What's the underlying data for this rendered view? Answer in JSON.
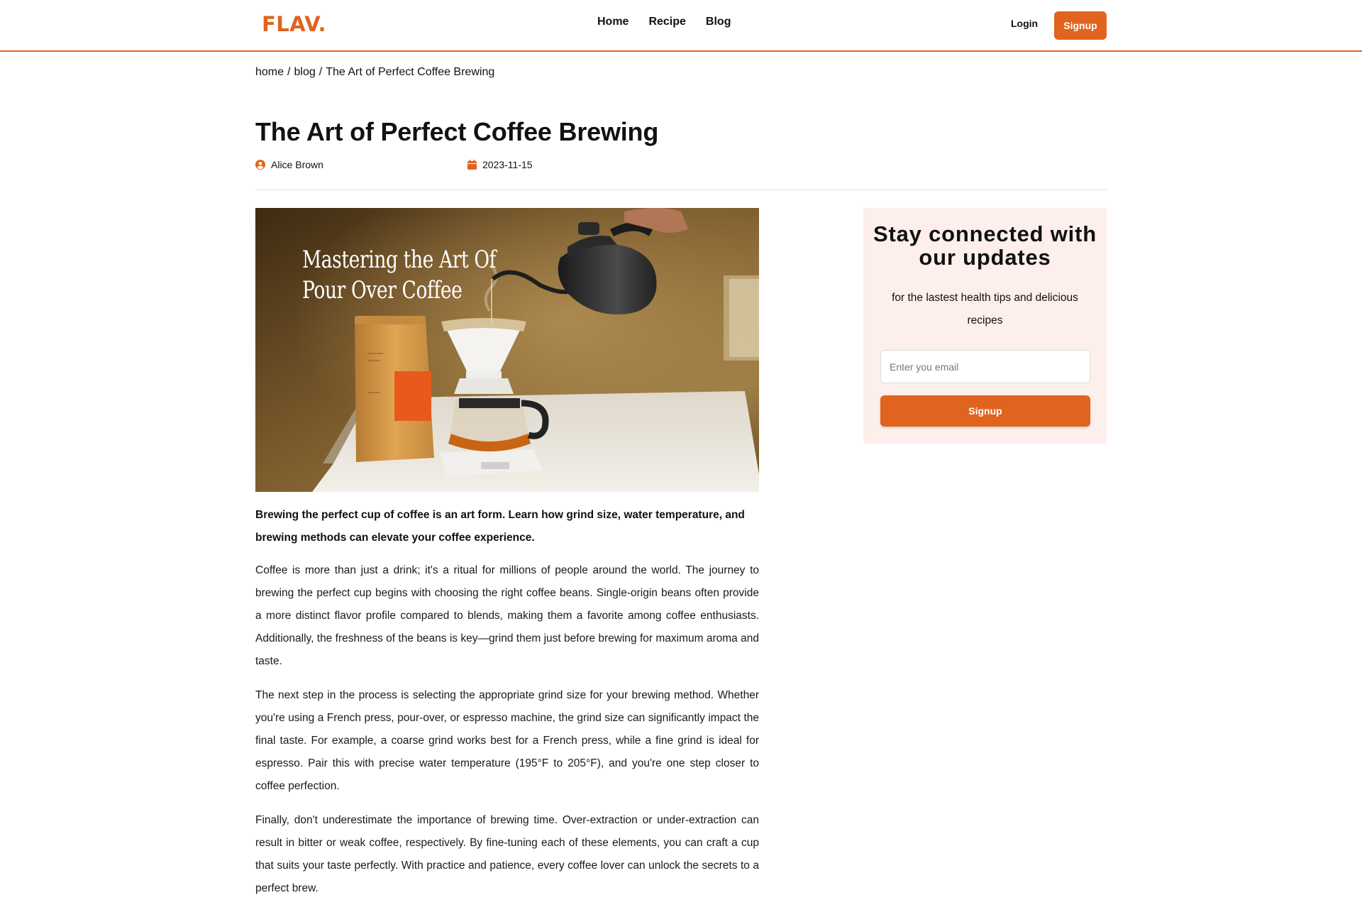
{
  "brand": {
    "logo_text": "FLAV.",
    "accent_color": "#E0641E"
  },
  "nav": {
    "items": [
      {
        "label": "Home"
      },
      {
        "label": "Recipe"
      },
      {
        "label": "Blog"
      }
    ],
    "login_label": "Login",
    "signup_label": "Signup"
  },
  "breadcrumb": {
    "home": "home",
    "blog": "blog",
    "current": "The Art of Perfect Coffee Brewing",
    "separator": "/"
  },
  "article": {
    "title": "The Art of Perfect Coffee Brewing",
    "author": "Alice Brown",
    "author_icon": "user-circle-icon",
    "date": "2023-11-15",
    "date_icon": "calendar-icon",
    "hero_image": {
      "overlay_line1": "Mastering the Art Of",
      "overlay_line2": "Pour Over Coffee"
    },
    "lead": "Brewing the perfect cup of coffee is an art form. Learn how grind size, water temperature, and brewing methods can elevate your coffee experience.",
    "paragraphs": [
      "Coffee is more than just a drink; it's a ritual for millions of people around the world. The journey to brewing the perfect cup begins with choosing the right coffee beans. Single-origin beans often provide a more distinct flavor profile compared to blends, making them a favorite among coffee enthusiasts. Additionally, the freshness of the beans is key—grind them just before brewing for maximum aroma and taste.",
      "The next step in the process is selecting the appropriate grind size for your brewing method. Whether you're using a French press, pour-over, or espresso machine, the grind size can significantly impact the final taste. For example, a coarse grind works best for a French press, while a fine grind is ideal for espresso. Pair this with precise water temperature (195°F to 205°F), and you're one step closer to coffee perfection.",
      "Finally, don't underestimate the importance of brewing time. Over-extraction or under-extraction can result in bitter or weak coffee, respectively. By fine-tuning each of these elements, you can craft a cup that suits your taste perfectly. With practice and patience, every coffee lover can unlock the secrets to a perfect brew."
    ]
  },
  "newsletter": {
    "heading": "Stay connected with our updates",
    "subtext": "for the lastest health tips and delicious recipes",
    "email_placeholder": "Enter you email",
    "email_value": "",
    "button_label": "Signup",
    "background_color": "#FDEFEB"
  }
}
